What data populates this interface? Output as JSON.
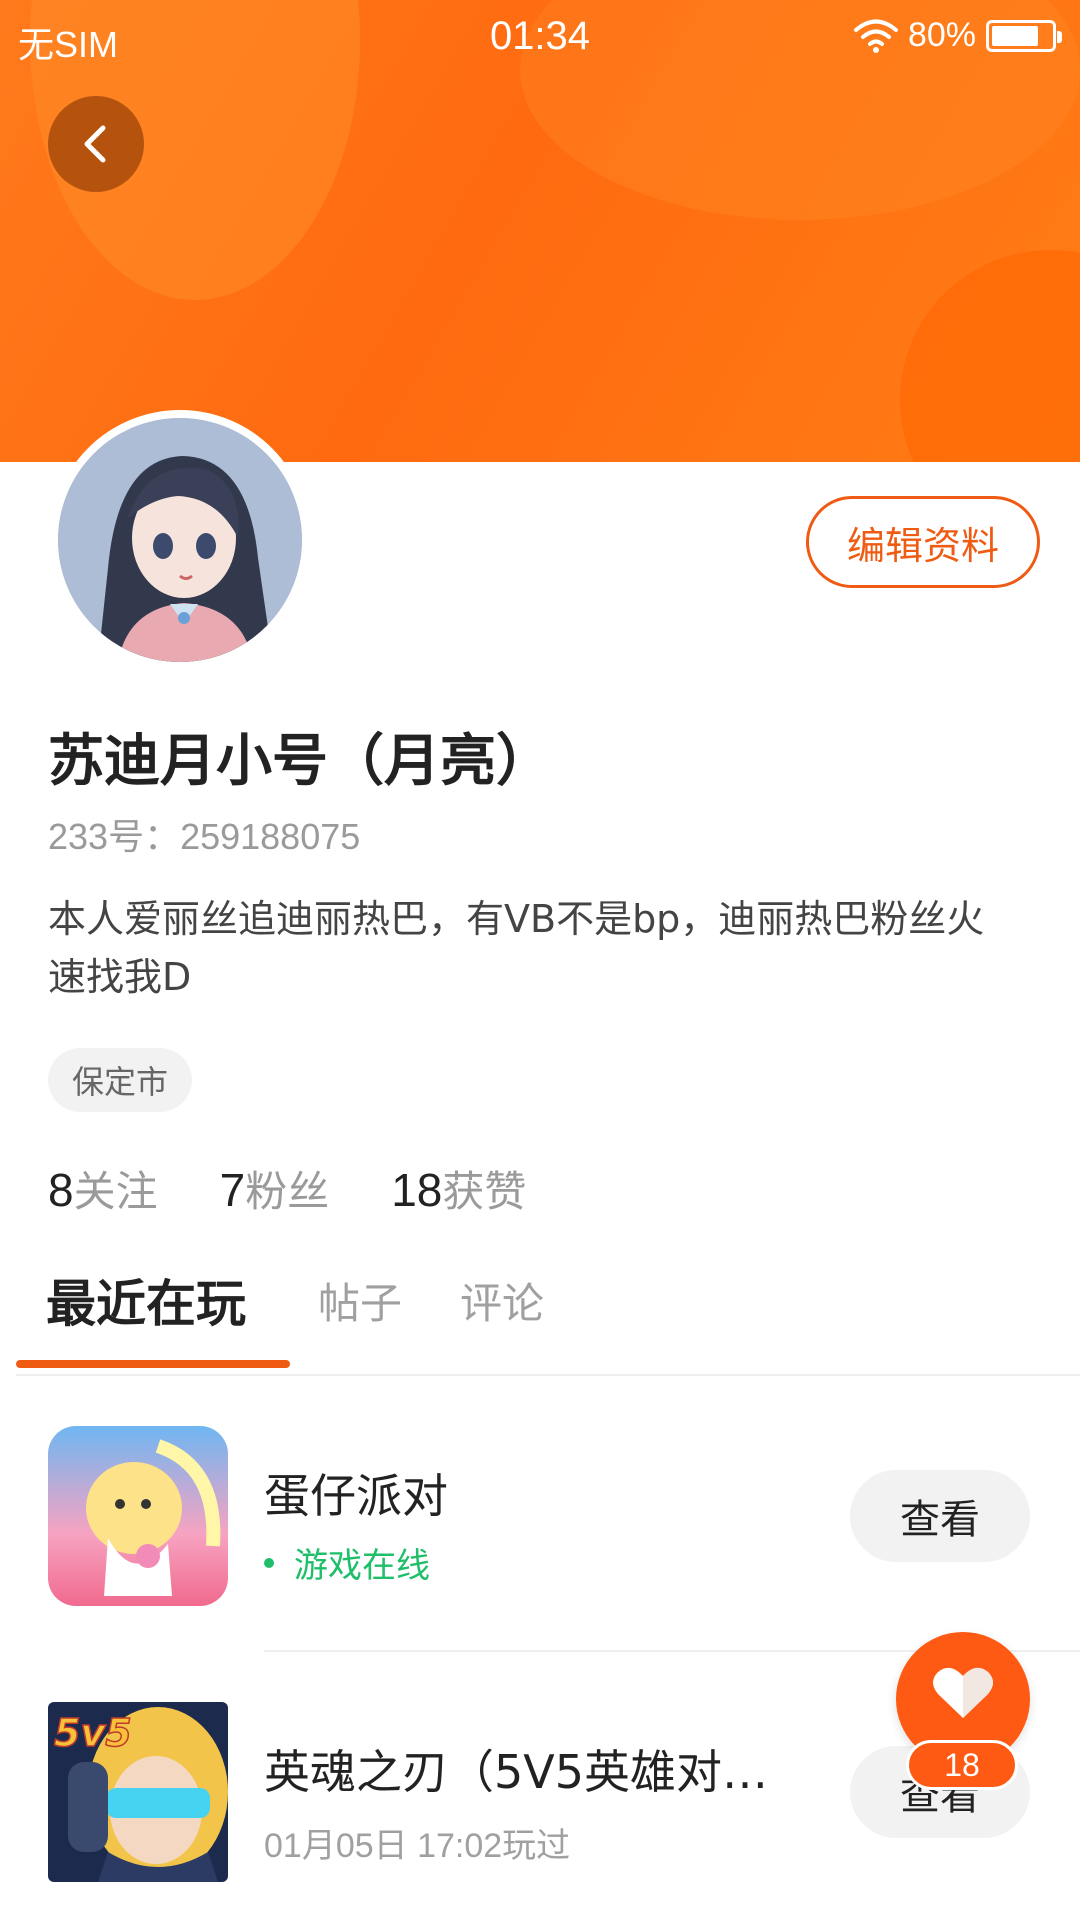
{
  "status_bar": {
    "carrier": "无SIM",
    "time": "01:34",
    "battery": "80%",
    "battery_level": 0.8
  },
  "profile": {
    "edit_label": "编辑资料",
    "username": "苏迪月小号（月亮）",
    "user_id": "233号：259188075",
    "bio": "本人爱丽丝追迪丽热巴，有VB不是bp，迪丽热巴粉丝火速找我D",
    "location": "保定市",
    "stats": [
      {
        "number": "8",
        "label": "关注"
      },
      {
        "number": "7",
        "label": "粉丝"
      },
      {
        "number": "18",
        "label": "获赞"
      }
    ]
  },
  "tabs": [
    {
      "label": "最近在玩",
      "active": true
    },
    {
      "label": "帖子",
      "active": false
    },
    {
      "label": "评论",
      "active": false
    }
  ],
  "games": [
    {
      "name": "蛋仔派对",
      "status": "游戏在线",
      "button": "查看"
    },
    {
      "name": "英魂之刃（5V5英雄对…",
      "status": "01月05日 17:02玩过",
      "button": "查看",
      "icon_text": "5v5"
    }
  ],
  "like_fab": {
    "count": "18"
  },
  "colors": {
    "accent": "#ef5b13",
    "online": "#1fbf6a",
    "banner": "#ff6a10"
  }
}
